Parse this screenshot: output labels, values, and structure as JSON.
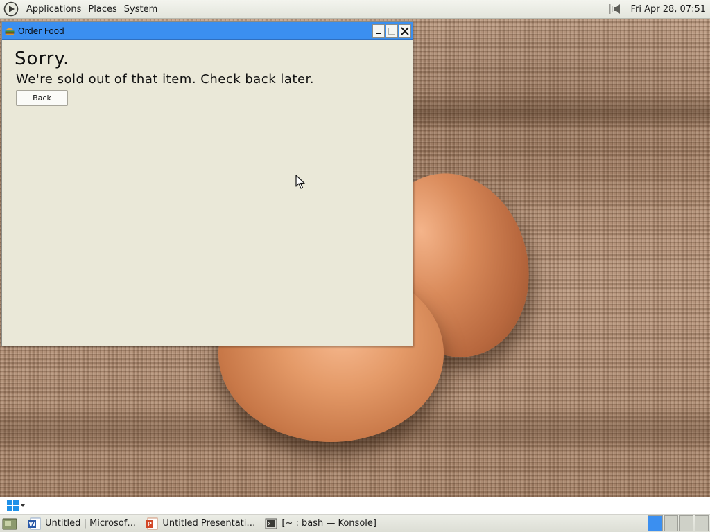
{
  "top_panel": {
    "menus": [
      "Applications",
      "Places",
      "System"
    ],
    "clock": "Fri Apr 28, 07:51",
    "volume_icon": "speaker-icon"
  },
  "window": {
    "title": "Order Food",
    "app_icon": "burger-icon",
    "heading": "Sorry.",
    "message": "We're sold out of that item. Check back later.",
    "back_button": "Back"
  },
  "taskbar": {
    "search_placeholder": "",
    "tasks": [
      {
        "label": "Untitled | Microsof…",
        "icon": "word-icon"
      },
      {
        "label": "Untitled Presentati…",
        "icon": "presentation-icon"
      },
      {
        "label": "[~ : bash — Konsole]",
        "icon": "terminal-icon"
      }
    ]
  },
  "colors": {
    "titlebar": "#3b8ff0",
    "window_bg": "#eae8d8",
    "panel_bg": "#e3e5dc"
  }
}
